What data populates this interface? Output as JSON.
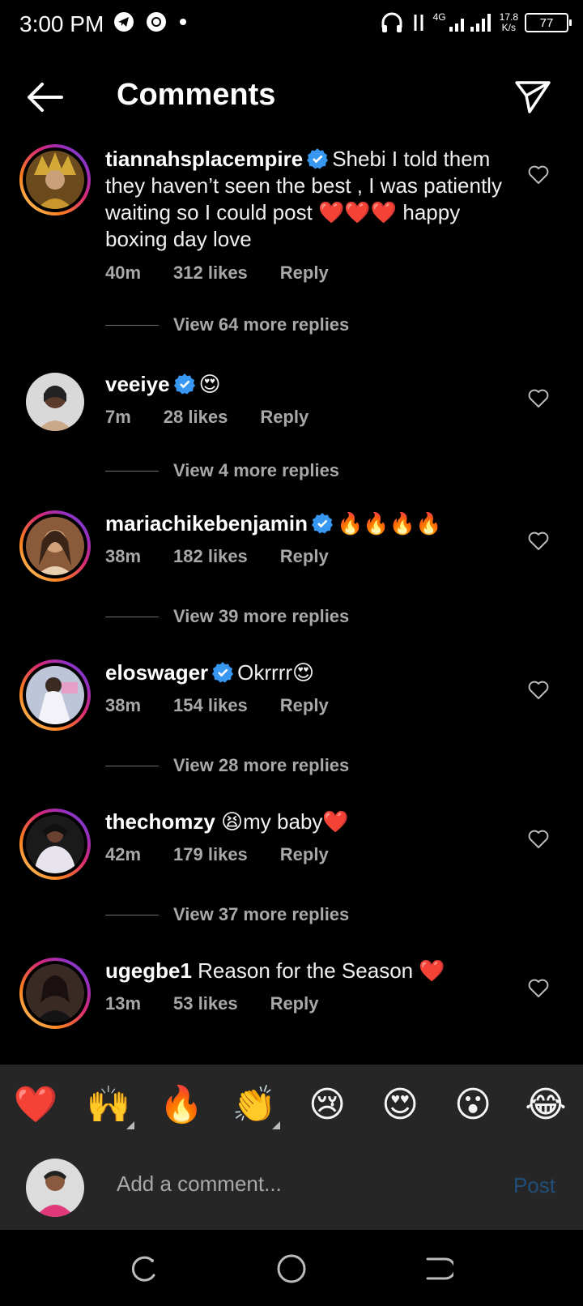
{
  "status_bar": {
    "time": "3:00 PM",
    "network_speed_value": "17.8",
    "network_speed_unit": "K/s",
    "battery": "77",
    "network_type": "4G",
    "icons": [
      "telegram-icon",
      "chrome-icon",
      "dot-icon",
      "headphones-icon",
      "signal-icon",
      "battery-icon"
    ]
  },
  "header": {
    "title": "Comments",
    "back_icon": "back-arrow-icon",
    "share_icon": "send-icon"
  },
  "comments": [
    {
      "username": "tiannahsplacempire",
      "verified": true,
      "text": "Shebi I told them they haven’t seen the best ,  I was patiently waiting so I could post ❤️❤️❤️ happy boxing day love",
      "time": "40m",
      "likes": "312 likes",
      "reply": "Reply",
      "view_replies": "View 64 more replies",
      "story_ring": true
    },
    {
      "username": "veeiye",
      "verified": true,
      "text": "😍",
      "time": "7m",
      "likes": "28 likes",
      "reply": "Reply",
      "view_replies": "View 4 more replies",
      "story_ring": false
    },
    {
      "username": "mariachikebenjamin",
      "verified": true,
      "text": "🔥🔥🔥🔥",
      "time": "38m",
      "likes": "182 likes",
      "reply": "Reply",
      "view_replies": "View 39 more replies",
      "story_ring": true
    },
    {
      "username": "eloswager",
      "verified": true,
      "text": "Okrrrr😍",
      "time": "38m",
      "likes": "154 likes",
      "reply": "Reply",
      "view_replies": "View 28 more replies",
      "story_ring": true
    },
    {
      "username": "thechomzy",
      "verified": false,
      "text": "😫my baby❤️",
      "time": "42m",
      "likes": "179 likes",
      "reply": "Reply",
      "view_replies": "View 37 more replies",
      "story_ring": true
    },
    {
      "username": "ugegbe1",
      "verified": false,
      "text": "Reason for the Season ❤️",
      "time": "13m",
      "likes": "53 likes",
      "reply": "Reply",
      "view_replies": "",
      "story_ring": true
    }
  ],
  "quick_reactions": [
    "❤️",
    "🙌",
    "🔥",
    "👏",
    "😢",
    "😍",
    "😮",
    "😂"
  ],
  "compose": {
    "placeholder": "Add a comment...",
    "post_label": "Post"
  },
  "nav_bar": {
    "icons": [
      "recent-apps-icon",
      "home-icon",
      "back-icon"
    ]
  },
  "colors": {
    "background": "#000000",
    "verified_blue": "#3897f0",
    "post_disabled": "#1f4f7a",
    "secondary_text": "#a8a8a8"
  }
}
